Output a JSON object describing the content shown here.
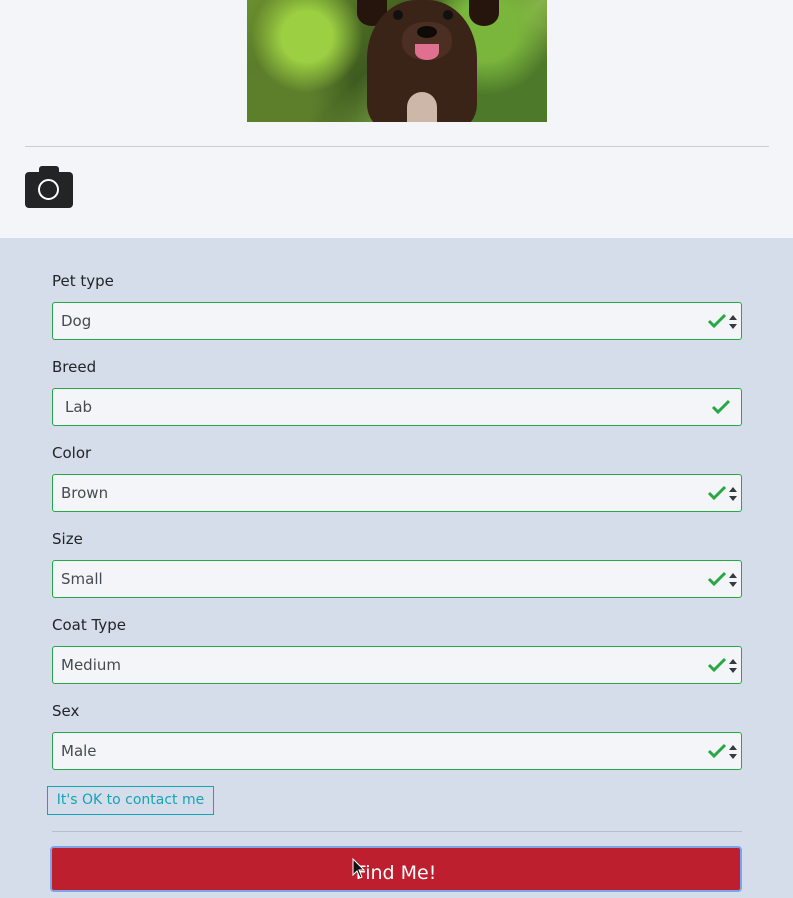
{
  "photo": {
    "icon": "dog-photo"
  },
  "camera": {
    "icon": "camera-icon"
  },
  "fields": [
    {
      "label": "Pet type",
      "value": "Dog",
      "kind": "select"
    },
    {
      "label": "Breed",
      "value": "Lab",
      "kind": "text"
    },
    {
      "label": "Color",
      "value": "Brown",
      "kind": "select"
    },
    {
      "label": "Size",
      "value": "Small",
      "kind": "select"
    },
    {
      "label": "Coat Type",
      "value": "Medium",
      "kind": "select"
    },
    {
      "label": "Sex",
      "value": "Male",
      "kind": "select"
    }
  ],
  "contact_label": "It's OK to contact me",
  "submit_label": "Find Me!",
  "colors": {
    "valid": "#28a745",
    "submit": "#bd1f2e",
    "contact": "#17a2b8",
    "form_bg": "#d4dde9",
    "top_bg": "#f4f5f8"
  }
}
